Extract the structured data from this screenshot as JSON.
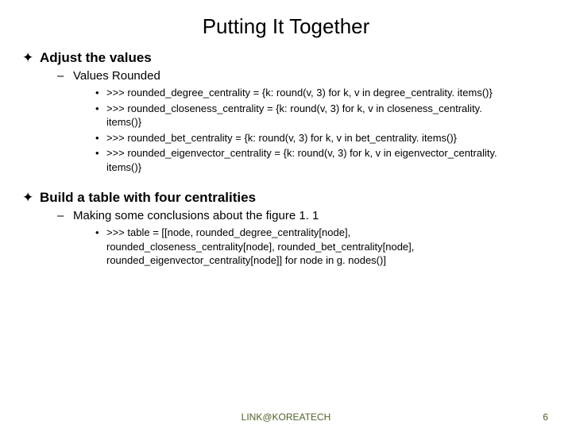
{
  "title": "Putting It Together",
  "section1": {
    "heading": "Adjust the values",
    "sub": "Values Rounded",
    "items": [
      ">>> rounded_degree_centrality = {k: round(v, 3) for k, v in degree_centrality. items()}",
      ">>> rounded_closeness_centrality = {k: round(v, 3) for k, v in closeness_centrality. items()}",
      ">>> rounded_bet_centrality = {k: round(v, 3) for k, v in bet_centrality. items()}",
      ">>> rounded_eigenvector_centrality = {k: round(v, 3) for k, v in eigenvector_centrality. items()}"
    ]
  },
  "section2": {
    "heading": "Build a table with four centralities",
    "sub": "Making some conclusions about the figure 1. 1",
    "items": [
      ">>> table = [[node, rounded_degree_centrality[node], rounded_closeness_centrality[node], rounded_bet_centrality[node], rounded_eigenvector_centrality[node]] for node in g. nodes()]"
    ]
  },
  "footer": {
    "org": "LINK@KOREATECH",
    "page": "6"
  },
  "bullets": {
    "l1": "✦",
    "l2": "–",
    "l3": "•"
  }
}
